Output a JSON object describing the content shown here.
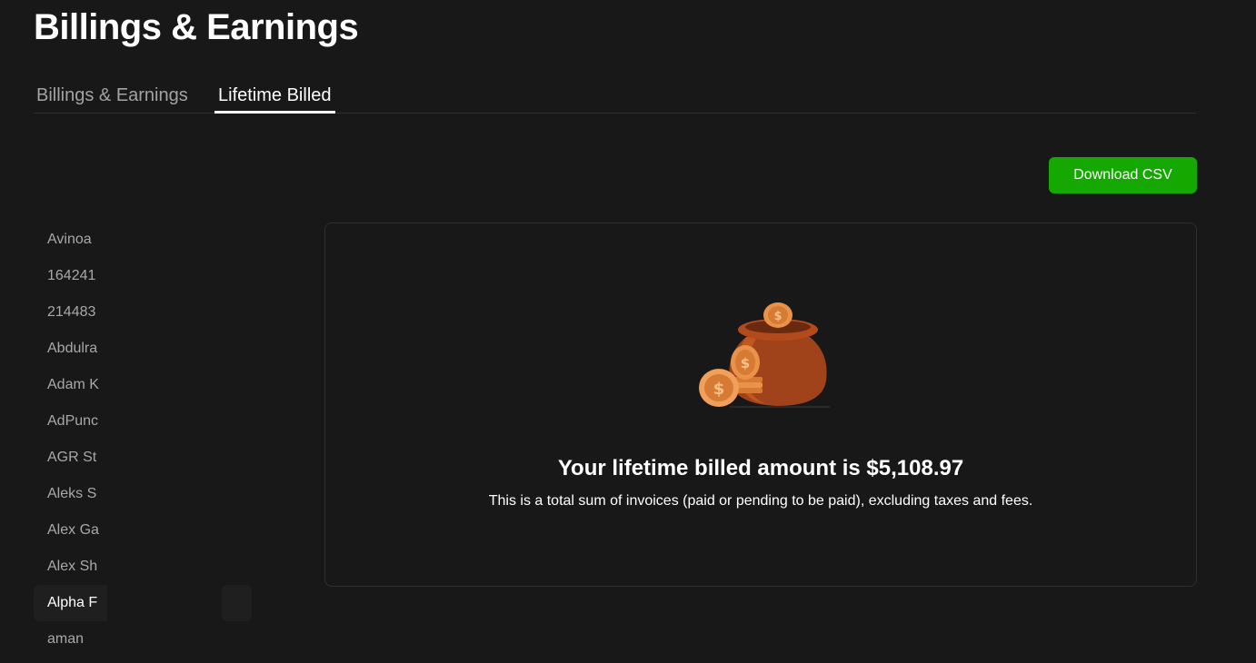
{
  "page": {
    "title": "Billings & Earnings"
  },
  "tabs": [
    {
      "label": "Billings & Earnings",
      "active": false
    },
    {
      "label": "Lifetime Billed",
      "active": true
    }
  ],
  "toolbar": {
    "download_label": "Download CSV"
  },
  "sidebar": {
    "items": [
      {
        "label": "Avinoa"
      },
      {
        "label": "164241"
      },
      {
        "label": "214483"
      },
      {
        "label": "Abdulra"
      },
      {
        "label": "Adam K"
      },
      {
        "label": "AdPunc"
      },
      {
        "label": "AGR St"
      },
      {
        "label": "Aleks S"
      },
      {
        "label": "Alex Ga"
      },
      {
        "label": "Alex Sh"
      },
      {
        "label": "Alpha F",
        "active": true
      },
      {
        "label": "aman"
      }
    ]
  },
  "summary": {
    "heading": "Your lifetime billed amount is $5,108.97",
    "description": "This is a total sum of invoices (paid or pending to be paid), excluding taxes and fees.",
    "illustration_icon": "money-pot-icon"
  },
  "colors": {
    "background": "#181818",
    "accent_green": "#14a800",
    "pot_brown": "#a0431a",
    "coin_gold": "#e8924a"
  }
}
